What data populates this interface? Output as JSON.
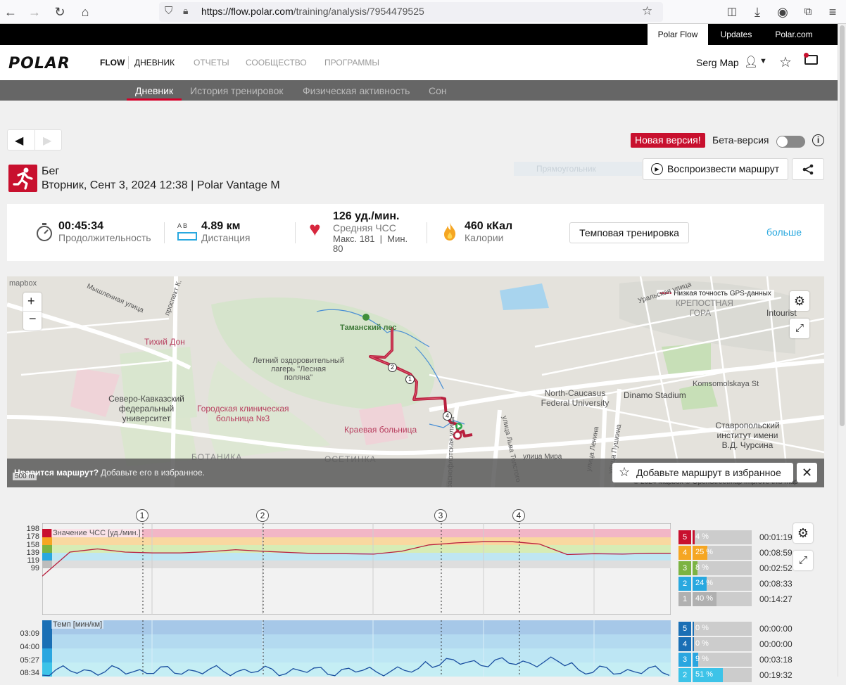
{
  "browser": {
    "url_host": "https://flow.polar.com",
    "url_path": "/training/analysis/7954479525"
  },
  "topbar": {
    "polar_flow": "Polar Flow",
    "updates": "Updates",
    "polar_com": "Polar.com"
  },
  "header": {
    "logo": "POLAR",
    "flow": "FLOW",
    "nav": [
      "ДНЕВНИК",
      "ОТЧЕТЫ",
      "СООБЩЕСТВО",
      "ПРОГРАММЫ"
    ],
    "user": "Serg Map"
  },
  "subnav": [
    "Дневник",
    "История тренировок",
    "Физическая активность",
    "Сон"
  ],
  "beta": {
    "new_version": "Новая версия!",
    "label": "Бета-версия",
    "info": "i"
  },
  "session": {
    "sport": "Бег",
    "date_line": "Вторник, Сент 3, 2024 12:38 | Polar Vantage M",
    "replay": "Воспроизвести маршрут",
    "ghost": "Прямоугольник"
  },
  "summary": {
    "duration": "00:45:34",
    "duration_label": "Продолжительность",
    "distance": "4.89 км",
    "distance_label": "Дистанция",
    "ab": "A   B",
    "hr": "126 уд./мин.",
    "hr_label": "Средняя ЧСС",
    "hr_maxmin": "Макс. 181  |  Мин.",
    "hr_min": "80",
    "calories": "460 кКал",
    "calories_label": "Калории",
    "type_button": "Темповая тренировка",
    "more": "больше"
  },
  "map": {
    "mapbox": "mapbox",
    "gps_warning": "Низкая точность GPS-данных",
    "labels": [
      "Тиxий Дон",
      "Летний оздоровительный\nлагерь \"Лесная\nполяна\"",
      "Таманский лес",
      "Северо-Кавказский\nфедеральный\nуниверситет",
      "Городская клиническая\nбольница №3",
      "Краевая больница",
      "North-Caucasus\nFederal University",
      "Dinamo Stadium",
      "Komsomolskaya St",
      "Ставропольский\nинститут имени\nВ.Д. Чурсина",
      "КРЕПОСТНАЯ\nГОРА",
      "Intourist",
      "Уральская улица",
      "ОСЕТИНКА",
      "БОТАНИКА",
      "улица Мира",
      "улица Льва Толстого",
      "Краснофлотская улица",
      "улица Ленина",
      "улица Пушкина",
      "проспект К.",
      "Мышленная улица"
    ],
    "like_q": "Нравится маршрут?",
    "like_text": "Добавьте его в избранное.",
    "fav_button": "Добавьте маршрут в избранное",
    "scale": "500 m",
    "attrib": "© 2024 Mapbox © OpenStreetMap Improve this map",
    "laps": [
      "1",
      "2",
      "4"
    ]
  },
  "chart_data": [
    {
      "type": "line",
      "title": "Значение ЧСС [уд./мин.]",
      "yticks": [
        "198",
        "178",
        "158",
        "139",
        "119",
        "99"
      ],
      "x": [
        0,
        2,
        4,
        6,
        8,
        10,
        12,
        14,
        16,
        18,
        20,
        22,
        24,
        26,
        28,
        30,
        32,
        34,
        36,
        38,
        40,
        42,
        44,
        45.5
      ],
      "values": [
        80,
        140,
        148,
        140,
        138,
        138,
        141,
        146,
        142,
        139,
        136,
        136,
        135,
        142,
        158,
        163,
        166,
        166,
        160,
        134,
        136,
        135,
        137,
        137
      ],
      "zones": [
        {
          "zone": "5",
          "pct": "4 %",
          "time": "00:01:19",
          "color": "#c8102e"
        },
        {
          "zone": "4",
          "pct": "25 %",
          "time": "00:08:59",
          "color": "#f5a623"
        },
        {
          "zone": "3",
          "pct": "8 %",
          "time": "00:02:52",
          "color": "#7cb342"
        },
        {
          "zone": "2",
          "pct": "24 %",
          "time": "00:08:33",
          "color": "#29a8df"
        },
        {
          "zone": "1",
          "pct": "40 %",
          "time": "00:14:27",
          "color": "#b0b0b0"
        }
      ]
    },
    {
      "type": "line",
      "title": "Темп [мин/км]",
      "yticks": [
        "03:09",
        "04:00",
        "05:27",
        "08:34"
      ],
      "zones": [
        {
          "zone": "5",
          "pct": "0 %",
          "time": "00:00:00",
          "color": "#1a6fb5"
        },
        {
          "zone": "4",
          "pct": "0 %",
          "time": "00:00:00",
          "color": "#1a6fb5"
        },
        {
          "zone": "3",
          "pct": "9 %",
          "time": "00:03:18",
          "color": "#2aa6e0"
        },
        {
          "zone": "2",
          "pct": "51 %",
          "time": "00:19:32",
          "color": "#3dc3e8"
        }
      ]
    }
  ],
  "laps": [
    "1",
    "2",
    "3",
    "4"
  ]
}
